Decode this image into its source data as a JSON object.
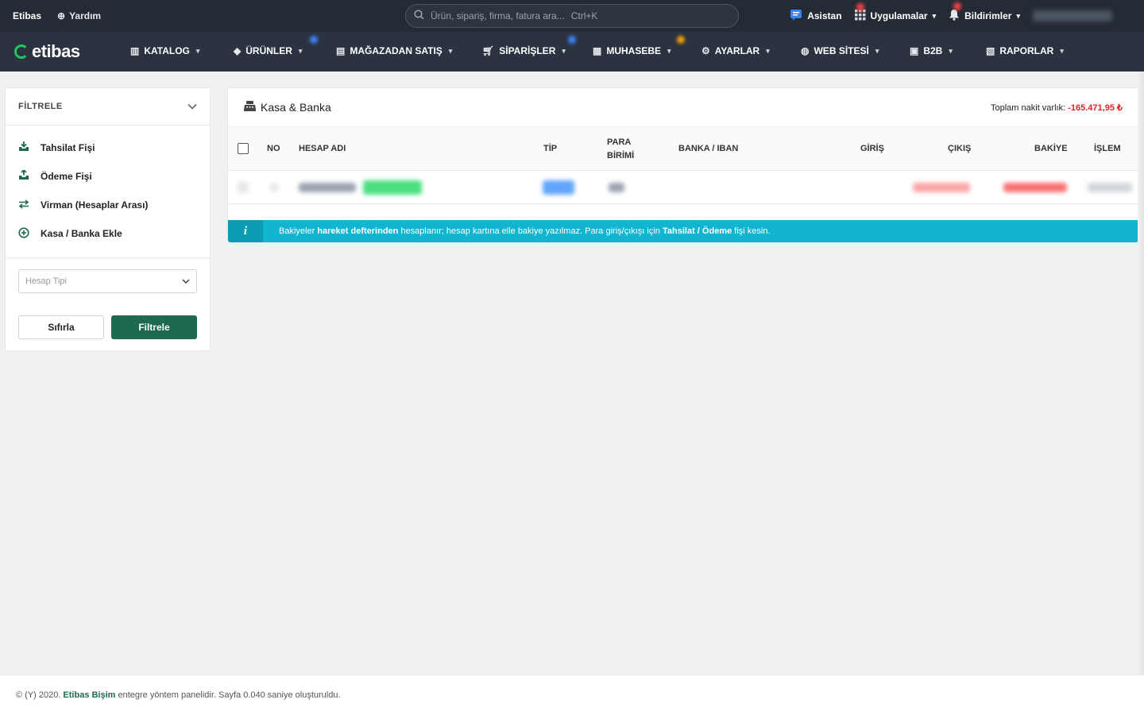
{
  "topbar": {
    "brand": "Etibas",
    "help": "Yardım",
    "search_placeholder": "Ürün, sipariş, firma, fatura ara...",
    "search_shortcut": "Ctrl+K",
    "assistant": "Asistan",
    "apps": "Uygulamalar",
    "notifications": "Bildirimler"
  },
  "nav": {
    "logo": "etibas",
    "items": [
      {
        "label": "KATALOG",
        "icon": "books-icon"
      },
      {
        "label": "ÜRÜNLER",
        "icon": "tag-icon"
      },
      {
        "label": "MAĞAZADAN SATIŞ",
        "icon": "store-icon"
      },
      {
        "label": "SİPARİŞLER",
        "icon": "cart-icon"
      },
      {
        "label": "MUHASEBE",
        "icon": "calculator-icon"
      },
      {
        "label": "AYARLAR",
        "icon": "gear-icon"
      },
      {
        "label": "WEB SİTESİ",
        "icon": "globe-icon"
      },
      {
        "label": "B2B",
        "icon": "shop-icon"
      },
      {
        "label": "RAPORLAR",
        "icon": "report-icon"
      }
    ]
  },
  "filter": {
    "title": "FİLTRELE",
    "menu": [
      {
        "label": "Tahsilat Fişi",
        "icon": "inbox-in-icon"
      },
      {
        "label": "Ödeme Fişi",
        "icon": "inbox-out-icon"
      },
      {
        "label": "Virman (Hesaplar Arası)",
        "icon": "transfer-icon"
      },
      {
        "label": "Kasa / Banka Ekle",
        "icon": "plus-circle-icon"
      }
    ],
    "select_placeholder": "Hesap Tipi",
    "reset": "Sıfırla",
    "apply": "Filtrele"
  },
  "card": {
    "title": "Kasa & Banka",
    "total_label": "Toplam nakit varlık:",
    "total_value": "-165.471,95 ₺",
    "columns": {
      "no": "NO",
      "name": "HESAP ADI",
      "type": "TİP",
      "currency_1": "PARA",
      "currency_2": "BİRİMİ",
      "bank": "BANKA / IBAN",
      "in": "GİRİŞ",
      "out": "ÇIKIŞ",
      "balance": "BAKİYE",
      "action": "İŞLEM"
    },
    "info": {
      "p1": "Bakiyeler ",
      "b1": "hareket defterinden",
      "p2": " hesaplanır; hesap kartına elle bakiye yazılmaz. Para giriş/çıkışı için ",
      "b2": "Tahsilat / Ödeme",
      "p3": " fişi kesin."
    }
  },
  "footer": {
    "p1": "© (Y) 2020.",
    "brand": "Etibas Bişim",
    "p2": "entegre yöntem panelidir. Sayfa 0.040 saniye oluşturuldu."
  },
  "colors": {
    "accent": "#1d6b4f",
    "info": "#12b5d0",
    "negative": "#dc2626"
  }
}
